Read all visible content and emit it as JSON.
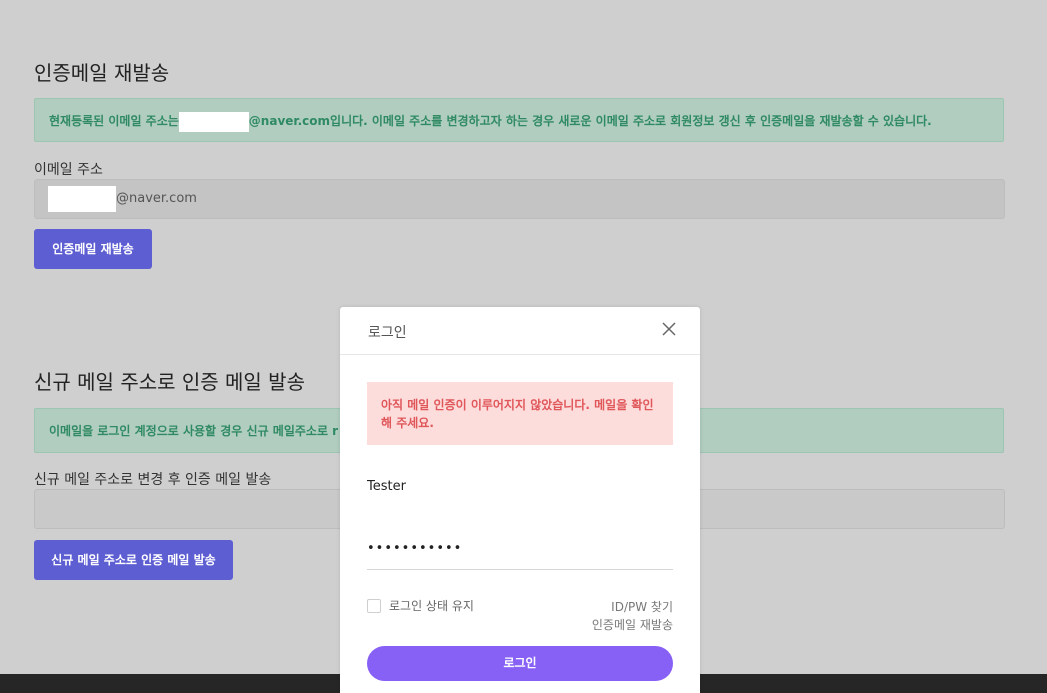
{
  "resend_section": {
    "title": "인증메일 재발송",
    "notice_prefix": "현재등록된 이메일 주소는",
    "notice_suffix": "@naver.com입니다. 이메일 주소를 변경하고자 하는 경우 새로운 이메일 주소로 회원정보 갱신 후 인증메일을 재발송할 수 있습니다.",
    "email_label": "이메일 주소",
    "email_value_suffix": "@naver.com",
    "button_label": "인증메일 재발송"
  },
  "new_email_section": {
    "title": "신규 메일 주소로 인증 메일 발송",
    "notice": "이메일을 로그인 계정으로 사용할 경우 신규 메일주소로 r",
    "field_label": "신규 메일 주소로 변경 후 인증 메일 발송",
    "field_value": "",
    "button_label": "신규 메일 주소로 인증 메일 발송"
  },
  "login_modal": {
    "title": "로그인",
    "error_message": "아직 메일 인증이 이루어지지 않았습니다. 메일을 확인해 주세요.",
    "username": "Tester",
    "password_masked": "•••••••••••",
    "remember_label": "로그인 상태 유지",
    "find_account_link": "ID/PW 찾기",
    "resend_link": "인증메일 재발송",
    "login_button": "로그인"
  },
  "colors": {
    "background_overlay": "#cfcfcf",
    "primary_button": "#5e5ed3",
    "login_button": "#8760f5",
    "success_text": "#2f8a63",
    "danger_text": "#e0575a",
    "danger_bg": "#fddcdc",
    "footer": "#262626"
  },
  "icons": {
    "close": "close-icon"
  }
}
